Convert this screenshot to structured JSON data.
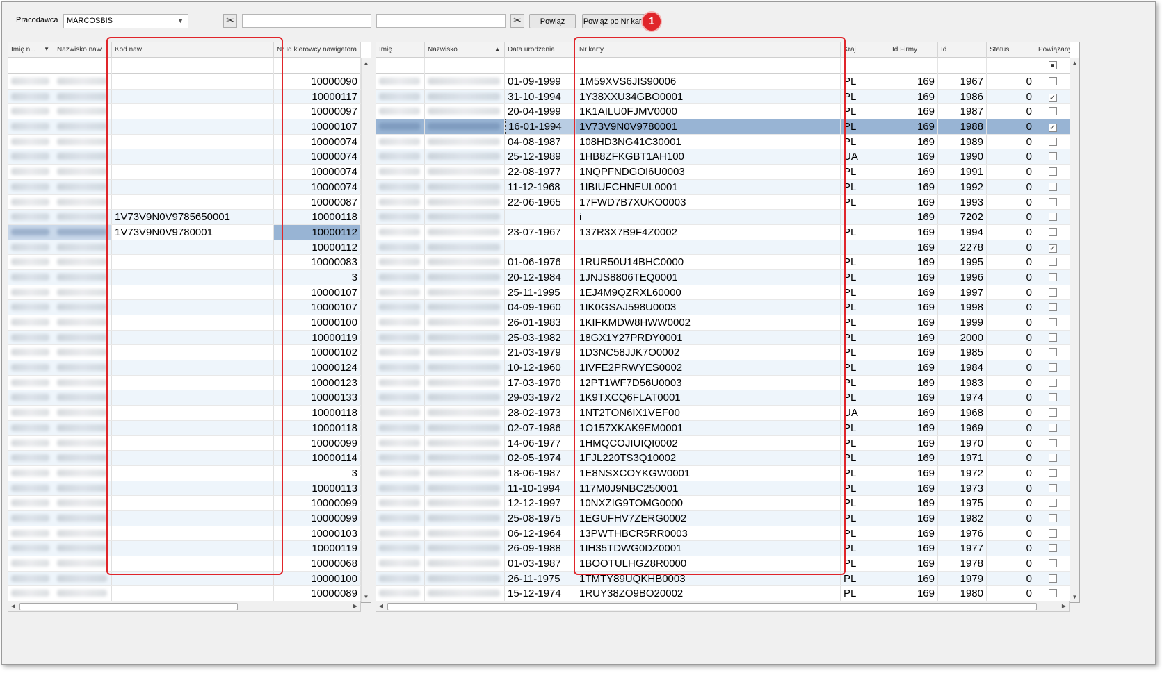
{
  "toolbar": {
    "employer_label": "Pracodawca",
    "employer_value": "MARCOSBIS",
    "link_button": "Powiąż",
    "link_by_card_button": "Powiąż po Nr karty",
    "badge": "1"
  },
  "left_grid": {
    "columns": [
      "Imię n...",
      "Nazwisko naw",
      "Kod naw",
      "Nr Id kierowcy nawigatora"
    ],
    "rows": [
      {
        "kod": "",
        "nr": "10000090"
      },
      {
        "kod": "",
        "nr": "10000117"
      },
      {
        "kod": "",
        "nr": "10000097"
      },
      {
        "kod": "",
        "nr": "10000107"
      },
      {
        "kod": "",
        "nr": "10000074"
      },
      {
        "kod": "",
        "nr": "10000074"
      },
      {
        "kod": "",
        "nr": "10000074"
      },
      {
        "kod": "",
        "nr": "10000074"
      },
      {
        "kod": "",
        "nr": "10000087"
      },
      {
        "kod": "1V73V9N0V9785650001",
        "nr": "10000118"
      },
      {
        "kod": "1V73V9N0V9780001",
        "nr": "10000112"
      },
      {
        "kod": "",
        "nr": "10000112"
      },
      {
        "kod": "",
        "nr": "10000083"
      },
      {
        "kod": "",
        "nr": "3"
      },
      {
        "kod": "",
        "nr": "10000107"
      },
      {
        "kod": "",
        "nr": "10000107"
      },
      {
        "kod": "",
        "nr": "10000100"
      },
      {
        "kod": "",
        "nr": "10000119"
      },
      {
        "kod": "",
        "nr": "10000102"
      },
      {
        "kod": "",
        "nr": "10000124"
      },
      {
        "kod": "",
        "nr": "10000123"
      },
      {
        "kod": "",
        "nr": "10000133"
      },
      {
        "kod": "",
        "nr": "10000118"
      },
      {
        "kod": "",
        "nr": "10000118"
      },
      {
        "kod": "",
        "nr": "10000099"
      },
      {
        "kod": "",
        "nr": "10000114"
      },
      {
        "kod": "",
        "nr": "3"
      },
      {
        "kod": "",
        "nr": "10000113"
      },
      {
        "kod": "",
        "nr": "10000099"
      },
      {
        "kod": "",
        "nr": "10000099"
      },
      {
        "kod": "",
        "nr": "10000103"
      },
      {
        "kod": "",
        "nr": "10000119"
      },
      {
        "kod": "",
        "nr": "10000068"
      },
      {
        "kod": "",
        "nr": "10000100"
      },
      {
        "kod": "",
        "nr": "10000089"
      }
    ]
  },
  "right_grid": {
    "columns": [
      "Imię",
      "Nazwisko",
      "Data urodzenia",
      "Nr karty",
      "Kraj",
      "Id Firmy",
      "Id",
      "Status",
      "Powiązany"
    ],
    "rows": [
      {
        "date": "01-09-1999",
        "card": "1M59XVS6JIS90006",
        "kraj": "PL",
        "firma": "169",
        "id": "1967",
        "status": "0",
        "linked": false
      },
      {
        "date": "31-10-1994",
        "card": "1Y38XXU34GBO0001",
        "kraj": "PL",
        "firma": "169",
        "id": "1986",
        "status": "0",
        "linked": true
      },
      {
        "date": "20-04-1999",
        "card": "1K1AILU0FJMV0000",
        "kraj": "PL",
        "firma": "169",
        "id": "1987",
        "status": "0",
        "linked": false
      },
      {
        "date": "16-01-1994",
        "card": "1V73V9N0V9780001",
        "kraj": "PL",
        "firma": "169",
        "id": "1988",
        "status": "0",
        "linked": true
      },
      {
        "date": "04-08-1987",
        "card": "108HD3NG41C30001",
        "kraj": "PL",
        "firma": "169",
        "id": "1989",
        "status": "0",
        "linked": false
      },
      {
        "date": "25-12-1989",
        "card": "1HB8ZFKGBT1AH100",
        "kraj": "UA",
        "firma": "169",
        "id": "1990",
        "status": "0",
        "linked": false
      },
      {
        "date": "22-08-1977",
        "card": "1NQPFNDGOI6U0003",
        "kraj": "PL",
        "firma": "169",
        "id": "1991",
        "status": "0",
        "linked": false
      },
      {
        "date": "11-12-1968",
        "card": "1IBIUFCHNEUL0001",
        "kraj": "PL",
        "firma": "169",
        "id": "1992",
        "status": "0",
        "linked": false
      },
      {
        "date": "22-06-1965",
        "card": "17FWD7B7XUKO0003",
        "kraj": "PL",
        "firma": "169",
        "id": "1993",
        "status": "0",
        "linked": false
      },
      {
        "date": "",
        "card": "i",
        "kraj": "",
        "firma": "169",
        "id": "7202",
        "status": "0",
        "linked": false
      },
      {
        "date": "23-07-1967",
        "card": "137R3X7B9F4Z0002",
        "kraj": "PL",
        "firma": "169",
        "id": "1994",
        "status": "0",
        "linked": false
      },
      {
        "date": "",
        "card": "",
        "kraj": "",
        "firma": "169",
        "id": "2278",
        "status": "0",
        "linked": true
      },
      {
        "date": "01-06-1976",
        "card": "1RUR50U14BHC0000",
        "kraj": "PL",
        "firma": "169",
        "id": "1995",
        "status": "0",
        "linked": false
      },
      {
        "date": "20-12-1984",
        "card": "1JNJS8806TEQ0001",
        "kraj": "PL",
        "firma": "169",
        "id": "1996",
        "status": "0",
        "linked": false
      },
      {
        "date": "25-11-1995",
        "card": "1EJ4M9QZRXL60000",
        "kraj": "PL",
        "firma": "169",
        "id": "1997",
        "status": "0",
        "linked": false
      },
      {
        "date": "04-09-1960",
        "card": "1IK0GSAJ598U0003",
        "kraj": "PL",
        "firma": "169",
        "id": "1998",
        "status": "0",
        "linked": false
      },
      {
        "date": "26-01-1983",
        "card": "1KIFKMDW8HWW0002",
        "kraj": "PL",
        "firma": "169",
        "id": "1999",
        "status": "0",
        "linked": false
      },
      {
        "date": "25-03-1982",
        "card": "18GX1Y27PRDY0001",
        "kraj": "PL",
        "firma": "169",
        "id": "2000",
        "status": "0",
        "linked": false
      },
      {
        "date": "21-03-1979",
        "card": "1D3NC58JJK7O0002",
        "kraj": "PL",
        "firma": "169",
        "id": "1985",
        "status": "0",
        "linked": false
      },
      {
        "date": "10-12-1960",
        "card": "1IVFE2PRWYES0002",
        "kraj": "PL",
        "firma": "169",
        "id": "1984",
        "status": "0",
        "linked": false
      },
      {
        "date": "17-03-1970",
        "card": "12PT1WF7D56U0003",
        "kraj": "PL",
        "firma": "169",
        "id": "1983",
        "status": "0",
        "linked": false
      },
      {
        "date": "29-03-1972",
        "card": "1K9TXCQ6FLAT0001",
        "kraj": "PL",
        "firma": "169",
        "id": "1974",
        "status": "0",
        "linked": false
      },
      {
        "date": "28-02-1973",
        "card": "1NT2TON6IX1VEF00",
        "kraj": "UA",
        "firma": "169",
        "id": "1968",
        "status": "0",
        "linked": false
      },
      {
        "date": "02-07-1986",
        "card": "1O157XKAK9EM0001",
        "kraj": "PL",
        "firma": "169",
        "id": "1969",
        "status": "0",
        "linked": false
      },
      {
        "date": "14-06-1977",
        "card": "1HMQCOJIUIQI0002",
        "kraj": "PL",
        "firma": "169",
        "id": "1970",
        "status": "0",
        "linked": false
      },
      {
        "date": "02-05-1974",
        "card": "1FJL220TS3Q10002",
        "kraj": "PL",
        "firma": "169",
        "id": "1971",
        "status": "0",
        "linked": false
      },
      {
        "date": "18-06-1987",
        "card": "1E8NSXCOYKGW0001",
        "kraj": "PL",
        "firma": "169",
        "id": "1972",
        "status": "0",
        "linked": false
      },
      {
        "date": "11-10-1994",
        "card": "117M0J9NBC250001",
        "kraj": "PL",
        "firma": "169",
        "id": "1973",
        "status": "0",
        "linked": false
      },
      {
        "date": "12-12-1997",
        "card": "10NXZIG9TOMG0000",
        "kraj": "PL",
        "firma": "169",
        "id": "1975",
        "status": "0",
        "linked": false
      },
      {
        "date": "25-08-1975",
        "card": "1EGUFHV7ZERG0002",
        "kraj": "PL",
        "firma": "169",
        "id": "1982",
        "status": "0",
        "linked": false
      },
      {
        "date": "06-12-1964",
        "card": "13PWTHBCR5RR0003",
        "kraj": "PL",
        "firma": "169",
        "id": "1976",
        "status": "0",
        "linked": false
      },
      {
        "date": "26-09-1988",
        "card": "1IH35TDWG0DZ0001",
        "kraj": "PL",
        "firma": "169",
        "id": "1977",
        "status": "0",
        "linked": false
      },
      {
        "date": "01-03-1987",
        "card": "1BOOTULHGZ8R0000",
        "kraj": "PL",
        "firma": "169",
        "id": "1978",
        "status": "0",
        "linked": false
      },
      {
        "date": "26-11-1975",
        "card": "1TMTY89UQKHB0003",
        "kraj": "PL",
        "firma": "169",
        "id": "1979",
        "status": "0",
        "linked": false
      },
      {
        "date": "15-12-1974",
        "card": "1RUY38ZO9BO20002",
        "kraj": "PL",
        "firma": "169",
        "id": "1980",
        "status": "0",
        "linked": false
      }
    ]
  },
  "icons": {
    "unlink_left": "scissors-icon",
    "unlink_right": "scissors-icon"
  },
  "colors": {
    "highlight": "#e0252a",
    "selected_row": "#98b4d4"
  }
}
